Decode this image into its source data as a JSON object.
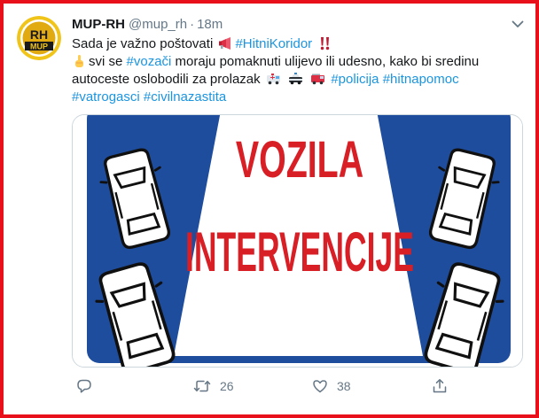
{
  "tweet": {
    "display_name": "MUP-RH",
    "handle": "@mup_rh",
    "separator": "·",
    "time": "18m",
    "avatar": {
      "top_text": "RH",
      "bottom_text": "MUP"
    },
    "text": {
      "l1_plain": "Sada je važno poštovati",
      "l1_tag": "#HitniKoridor",
      "l2_plain_1": "svi se",
      "l2_tag": "#vozači",
      "l2_plain_2": "moraju pomaknuti ulijevo ili udesno, kako bi sredinu",
      "l3_plain": "autoceste oslobodili za prolazak",
      "l3_tag_1": "#policija",
      "l3_tag_2": "#hitnapomoc",
      "l4_tag_1": "#vatrogasci",
      "l4_tag_2": "#civilnazastita"
    },
    "media": {
      "sign_line_1": "VOZILA",
      "sign_line_2": "INTERVENCIJE"
    },
    "actions": {
      "replies": "",
      "retweets": "26",
      "likes": "38"
    }
  },
  "icons": {
    "caret": "chevron-down-icon",
    "megaphone": "megaphone-emoji-icon",
    "exclamation": "double-exclamation-emoji-icon",
    "finger": "pointing-up-emoji-icon",
    "ambulance": "ambulance-emoji-icon",
    "police": "police-car-emoji-icon",
    "fire": "fire-engine-emoji-icon",
    "reply": "reply-icon",
    "retweet": "retweet-icon",
    "like": "heart-icon",
    "share": "share-icon"
  },
  "colors": {
    "border": "#e8101a",
    "link": "#1b95e0",
    "muted": "#657786",
    "sign_blue": "#1f4d9e",
    "sign_red": "#d81f26"
  }
}
